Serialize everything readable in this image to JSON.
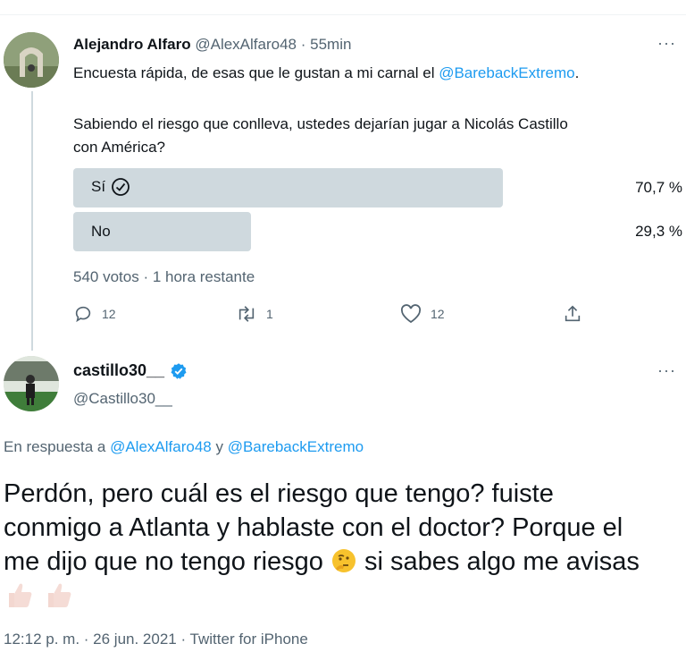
{
  "tweet1": {
    "author_name": "Alejandro Alfaro",
    "author_handle": "@AlexAlfaro48",
    "time": "· 55min",
    "text_before": "Encuesta rápida, de esas que le gustan a mi carnal el ",
    "mention": "@BarebackExtremo",
    "text_after": ".",
    "question_line1": "Sabiendo el riesgo que conlleva, ustedes dejarían jugar a Nicolás Castillo",
    "question_line2": "con América?",
    "poll": {
      "options": [
        {
          "label": "Sí",
          "percent_text": "70,7 %",
          "value": 70.7,
          "selected": true
        },
        {
          "label": "No",
          "percent_text": "29,3 %",
          "value": 29.3,
          "selected": false
        }
      ],
      "summary": "540 votos · 1 hora restante"
    },
    "actions": {
      "replies": "12",
      "retweets": "1",
      "likes": "12"
    }
  },
  "tweet2": {
    "author_name": "castillo30__",
    "author_handle": "@Castillo30__",
    "reply_prefix": "En respuesta a ",
    "reply_mention1": "@AlexAlfaro48",
    "reply_and": " y ",
    "reply_mention2": "@BarebackExtremo",
    "body_line1": "Perdón, pero cuál es el riesgo que tengo? fuiste",
    "body_line2": "conmigo a Atlanta y hablaste con el doctor? Porque el",
    "body_line3_a": "me dijo que no tengo riesgo ",
    "body_line3_b": " si sabes algo me avisas",
    "footer": "12:12 p. m. · 26 jun. 2021 · Twitter for iPhone"
  },
  "colors": {
    "accent": "#1d9bf0",
    "poll_bar": "#cfd9de",
    "muted": "#536471"
  }
}
